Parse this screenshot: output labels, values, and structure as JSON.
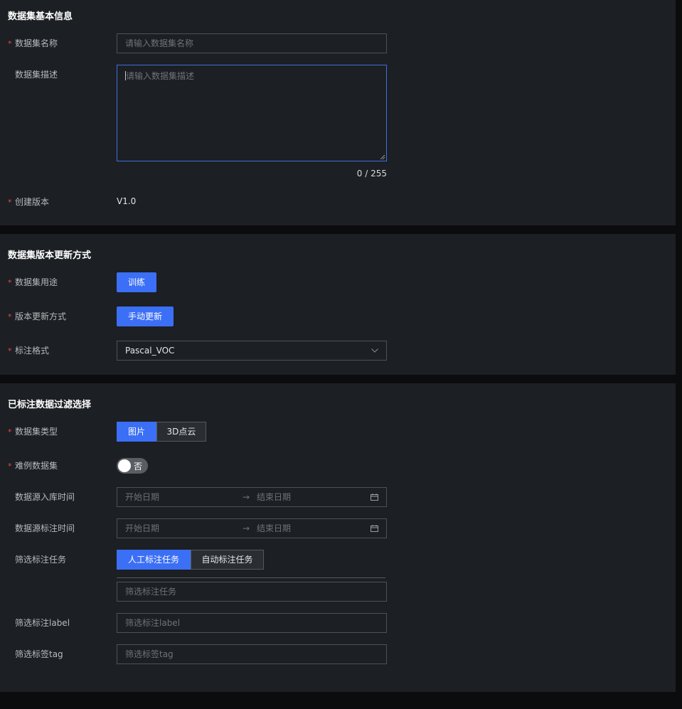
{
  "section1": {
    "title": "数据集基本信息",
    "name_label": "数据集名称",
    "name_placeholder": "请输入数据集名称",
    "desc_label": "数据集描述",
    "desc_placeholder": "请输入数据集描述",
    "desc_counter": "0 / 255",
    "version_label": "创建版本",
    "version_value": "V1.0"
  },
  "section2": {
    "title": "数据集版本更新方式",
    "usage_label": "数据集用途",
    "usage_button": "训练",
    "update_label": "版本更新方式",
    "update_button": "手动更新",
    "format_label": "标注格式",
    "format_value": "Pascal_VOC"
  },
  "section3": {
    "title": "已标注数据过滤选择",
    "type_label": "数据集类型",
    "type_options": [
      "图片",
      "3D点云"
    ],
    "type_selected": "图片",
    "hard_label": "难例数据集",
    "hard_toggle_text": "否",
    "hard_toggle_on": false,
    "import_time_label": "数据源入库时间",
    "label_time_label": "数据源标注时间",
    "date_start_placeholder": "开始日期",
    "date_end_placeholder": "结束日期",
    "date_separator": "→",
    "task_label": "筛选标注任务",
    "task_options": [
      "人工标注任务",
      "自动标注任务"
    ],
    "task_selected": "人工标注任务",
    "task_placeholder": "筛选标注任务",
    "label_filter_label": "筛选标注label",
    "label_filter_placeholder": "筛选标注label",
    "tag_filter_label": "筛选标签tag",
    "tag_filter_placeholder": "筛选标签tag"
  },
  "colors": {
    "panel_bg": "#1c1f23",
    "page_bg": "#0b0c0e",
    "accent": "#3b6ff5",
    "required": "#e04a3f"
  },
  "icons": {
    "dropdown": "chevron-down-icon",
    "calendar": "calendar-icon",
    "resize": "resize-grip-icon"
  }
}
